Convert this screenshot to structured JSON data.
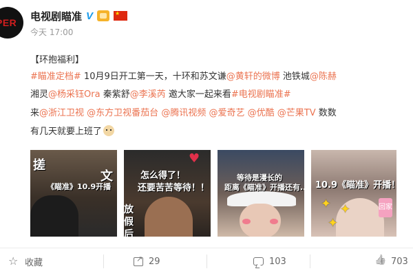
{
  "avatar": {
    "text": "PER"
  },
  "header": {
    "user_name": "电视剧瞄准",
    "verified_mark": "V",
    "time": "今天 17:00"
  },
  "post": {
    "line1": "【环抱福利】",
    "line2_segments": [
      {
        "text": "#瞄准定档#",
        "link": true
      },
      {
        "text": " 10月9日开工第一天，十环和苏文谦",
        "link": false
      },
      {
        "text": "@黄轩的微博",
        "link": true
      },
      {
        "text": " 池铁城",
        "link": false
      },
      {
        "text": "@陈赫",
        "link": true
      }
    ],
    "line3_segments": [
      {
        "text": "湘灵",
        "link": false
      },
      {
        "text": "@杨采钰Ora",
        "link": true
      },
      {
        "text": " 秦紫舒",
        "link": false
      },
      {
        "text": "@李溪芮",
        "link": true
      },
      {
        "text": " 邀大家一起来看",
        "link": false
      },
      {
        "text": "#电视剧瞄准#",
        "link": true
      }
    ],
    "line4_segments": [
      {
        "text": "来",
        "link": false
      },
      {
        "text": "@浙江卫视",
        "link": true
      },
      {
        "text": " ",
        "link": false
      },
      {
        "text": "@东方卫视番茄台",
        "link": true
      },
      {
        "text": " ",
        "link": false
      },
      {
        "text": "@腾讯视频",
        "link": true
      },
      {
        "text": " ",
        "link": false
      },
      {
        "text": "@爱奇艺",
        "link": true
      },
      {
        "text": " ",
        "link": false
      },
      {
        "text": "@优酷",
        "link": true
      },
      {
        "text": " ",
        "link": false
      },
      {
        "text": "@芒果TV",
        "link": true
      },
      {
        "text": " 数数",
        "link": false
      }
    ],
    "line5": "有几天就要上班了"
  },
  "images": [
    {
      "captions": [
        "搓",
        "文",
        "《瞄准》10.9开播"
      ]
    },
    {
      "captions": [
        "怎么得了！",
        "还要苦苦等待！！",
        "放假后"
      ]
    },
    {
      "captions": [
        "等待是漫长的",
        "距离《瞄准》开播还有..."
      ]
    },
    {
      "captions": [
        "10.9《瞄准》开播！"
      ],
      "sticker": "回家"
    }
  ],
  "actions": {
    "favorite_label": "收藏",
    "share_count": "29",
    "comment_count": "103",
    "like_count": "703"
  },
  "colors": {
    "link": "#eb7350",
    "verified": "#1a9bea",
    "avatar_text": "#d21e1e"
  }
}
